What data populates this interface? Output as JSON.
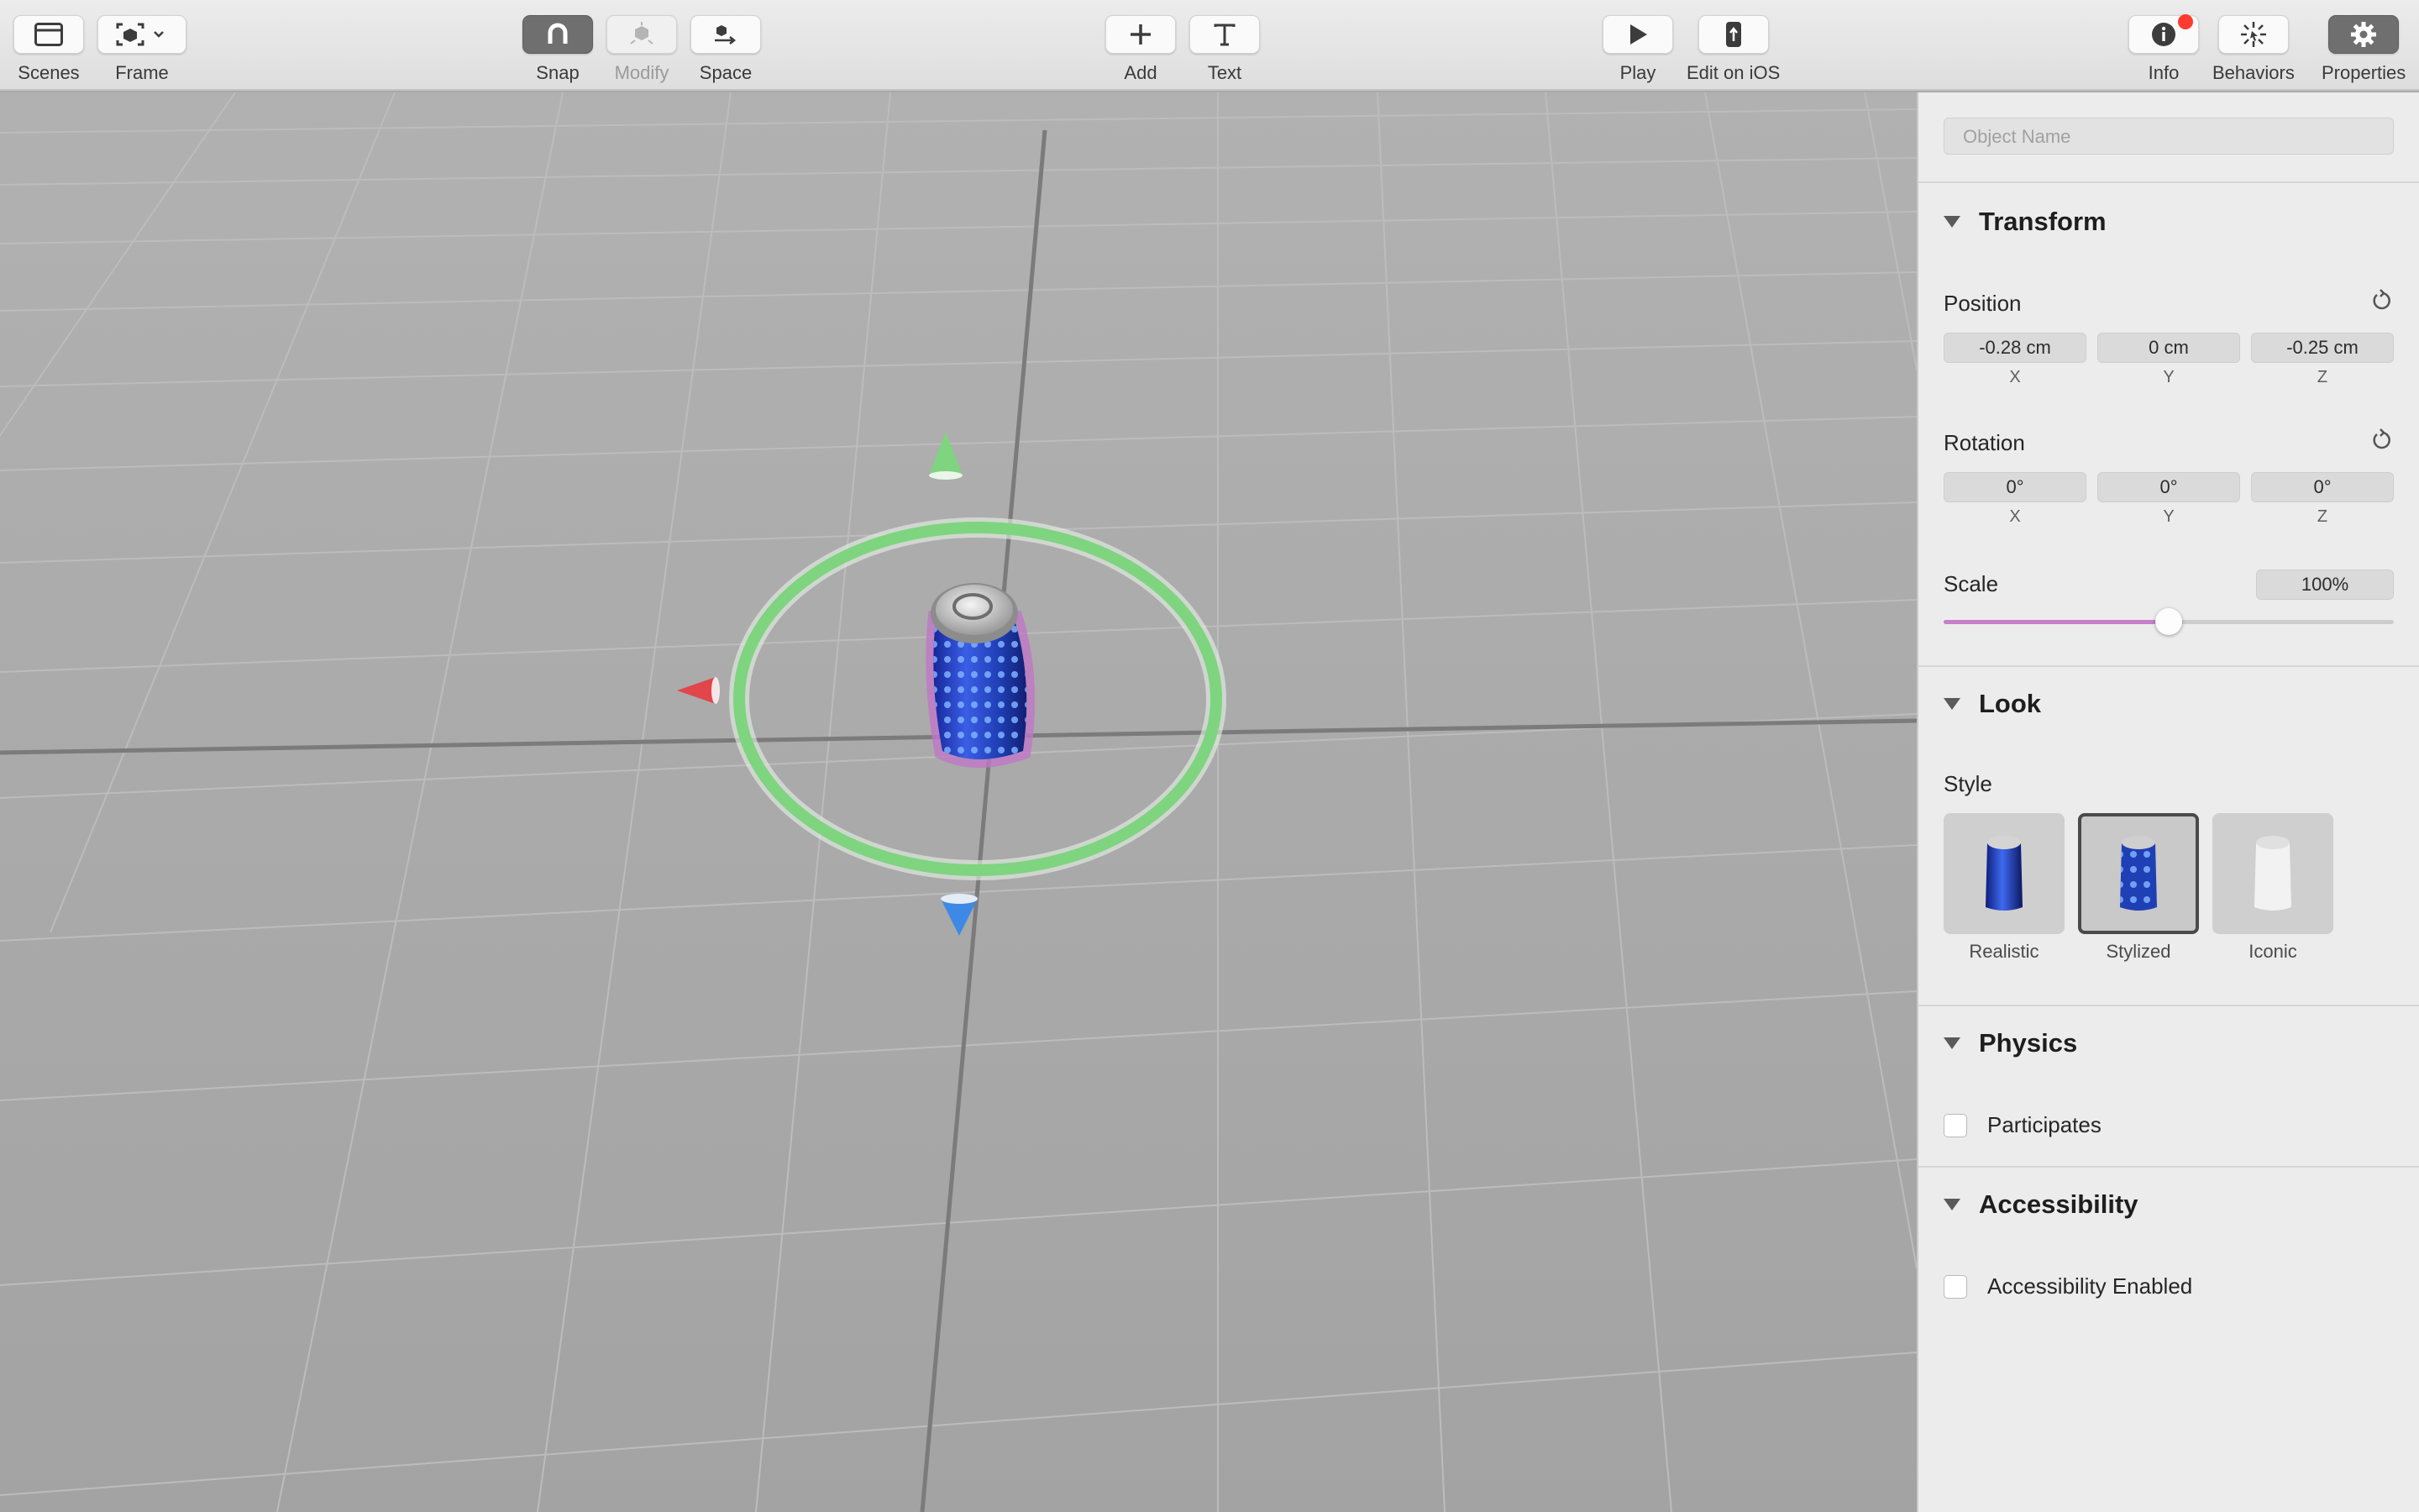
{
  "toolbar": {
    "scenes": "Scenes",
    "frame": "Frame",
    "snap": "Snap",
    "modify": "Modify",
    "space": "Space",
    "add": "Add",
    "text": "Text",
    "play": "Play",
    "edit_on_ios": "Edit on iOS",
    "info": "Info",
    "behaviors": "Behaviors",
    "properties": "Properties"
  },
  "inspector": {
    "object_name_placeholder": "Object Name",
    "transform": {
      "title": "Transform",
      "position_label": "Position",
      "position": {
        "x": "-0.28 cm",
        "y": "0 cm",
        "z": "-0.25 cm"
      },
      "rotation_label": "Rotation",
      "rotation": {
        "x": "0°",
        "y": "0°",
        "z": "0°"
      },
      "axes": {
        "x": "X",
        "y": "Y",
        "z": "Z"
      },
      "scale_label": "Scale",
      "scale_value": "100%",
      "scale_slider_fraction": 0.5
    },
    "look": {
      "title": "Look",
      "style_label": "Style",
      "styles": [
        "Realistic",
        "Stylized",
        "Iconic"
      ],
      "selected_style": "Stylized"
    },
    "physics": {
      "title": "Physics",
      "participates_label": "Participates",
      "participates_checked": false
    },
    "accessibility": {
      "title": "Accessibility",
      "enabled_label": "Accessibility Enabled",
      "enabled_checked": false
    }
  },
  "colors": {
    "accent_slider": "#c77fc8",
    "rotation_ring": "#7fd47f",
    "notification_dot": "#ff3b30",
    "can_blue": "#1f3fb5"
  }
}
